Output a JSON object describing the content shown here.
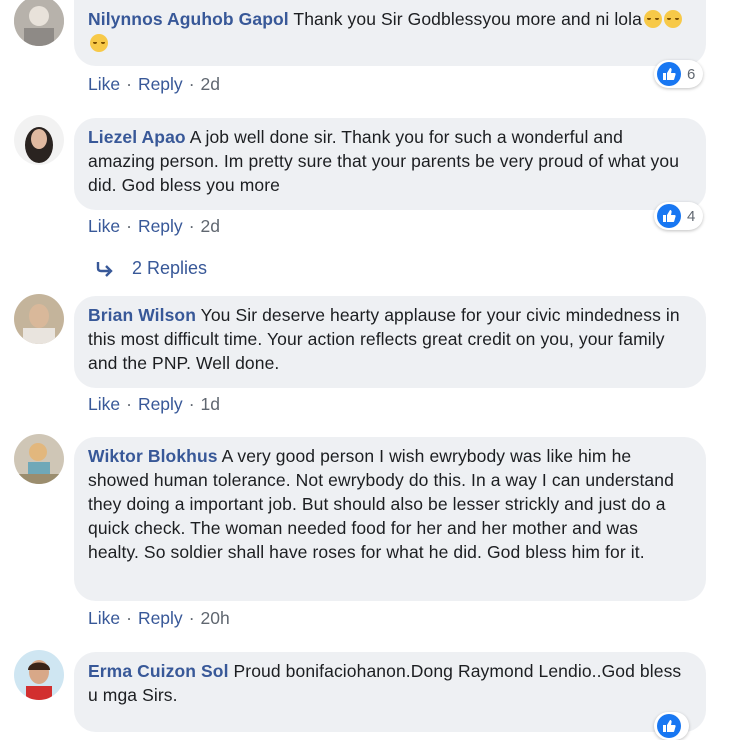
{
  "colors": {
    "author_blue": "#385898",
    "bubble_bg": "#eef0f3",
    "meta_gray": "#606770",
    "like_blue": "#1877f2"
  },
  "comments": [
    {
      "author": "Nilynnos Aguhob Gapol",
      "text": "Thank you Sir Godblessyou more and ni lola",
      "emoji_count": 3,
      "like_label": "Like",
      "reply_label": "Reply",
      "time": "2d",
      "reaction_count": "6",
      "avatar_icon": "profile-photo"
    },
    {
      "author": "Liezel Apao",
      "text": "A job well done sir. Thank you for such a wonderful and amazing person. Im pretty sure that your parents be very proud of what you did. God bless you more",
      "like_label": "Like",
      "reply_label": "Reply",
      "time": "2d",
      "reaction_count": "4",
      "avatar_icon": "profile-photo",
      "replies_label": "2 Replies"
    },
    {
      "author": "Brian Wilson",
      "text": "You Sir deserve hearty applause for your civic mindedness in this most difficult time. Your action reflects great credit on you, your family and the PNP. Well done.",
      "like_label": "Like",
      "reply_label": "Reply",
      "time": "1d",
      "avatar_icon": "profile-photo"
    },
    {
      "author": "Wiktor Blokhus",
      "text": "A very good person I wish ewrybody was like him he showed human tolerance. Not ewrybody do this. In a way I can understand they doing a important job. But should also be lesser strickly and just do a quick check. The woman needed food for her and her mother and was healty. So soldier shall have roses for what he did. God bless him for it.",
      "like_label": "Like",
      "reply_label": "Reply",
      "time": "20h",
      "avatar_icon": "profile-photo"
    },
    {
      "author": "Erma Cuizon Sol",
      "text": "Proud bonifaciohanon.Dong Raymond Lendio..God bless u mga Sirs.",
      "avatar_icon": "profile-photo"
    }
  ]
}
